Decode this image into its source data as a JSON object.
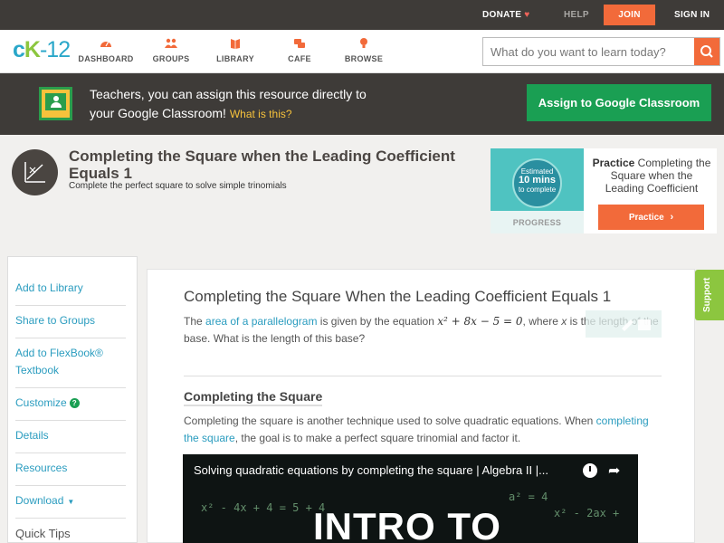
{
  "topbar": {
    "donate": "DONATE",
    "help": "HELP",
    "join": "JOIN",
    "signin": "SIGN IN"
  },
  "nav": {
    "logo_c": "c",
    "logo_k": "K",
    "logo_num": "-12",
    "items": [
      {
        "label": "DASHBOARD",
        "icon": "dashboard-icon"
      },
      {
        "label": "GROUPS",
        "icon": "groups-icon"
      },
      {
        "label": "LIBRARY",
        "icon": "library-icon"
      },
      {
        "label": "CAFE",
        "icon": "cafe-icon"
      },
      {
        "label": "BROWSE",
        "icon": "browse-icon"
      }
    ],
    "search_placeholder": "What do you want to learn today?"
  },
  "banner": {
    "line1": "Teachers, you can assign this resource directly to",
    "line2": "your Google Classroom!",
    "what": "What is this?",
    "assign": "Assign to Google Classroom"
  },
  "lesson": {
    "title": "Completing the Square when the Leading Coefficient Equals 1",
    "subtitle": "Complete the perfect square to solve simple trinomials"
  },
  "practice": {
    "estimated": "Estimated",
    "mins": "10 mins",
    "to_complete": "to complete",
    "progress": "PROGRESS",
    "bold": "Practice",
    "text": "Completing the Square when the Leading Coefficient",
    "button": "Practice"
  },
  "sidebar": {
    "items": [
      {
        "label": "Add to Library"
      },
      {
        "label": "Share to Groups"
      },
      {
        "label": "Add to FlexBook® Textbook"
      },
      {
        "label": "Customize"
      },
      {
        "label": "Details"
      },
      {
        "label": "Resources"
      },
      {
        "label": "Download"
      }
    ],
    "tips": "Quick Tips"
  },
  "content": {
    "title": "Completing the Square When the Leading Coefficient Equals 1",
    "p1_pre": "The",
    "p1_link": "area of a parallelogram",
    "p1_mid": "is given by the equation",
    "p1_eq": "x² + 8x − 5 = 0",
    "p1_post": ", where",
    "p1_var": "x",
    "p1_end": "is the length of the base. What is the length of this base?",
    "section": "Completing the Square",
    "p2_pre": "Completing the square is another technique used to solve quadratic equations. When",
    "p2_link": "completing the square",
    "p2_post": ", the goal is to make a perfect square trinomial and factor it."
  },
  "video": {
    "title": "Solving quadratic equations by completing the square | Algebra II |...",
    "big": "INTRO TO",
    "chalk1": "x² - 4x + 4 = 5 + 4",
    "chalk2": "a² = 4",
    "chalk3": "x² - 2ax +"
  },
  "support": "Support"
}
